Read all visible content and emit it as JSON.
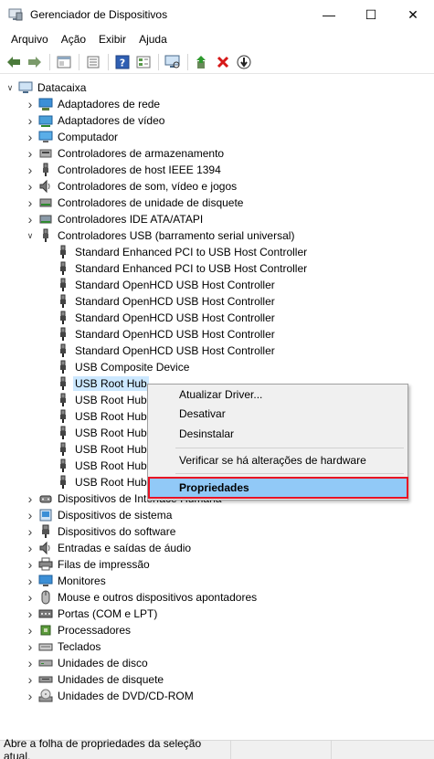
{
  "window": {
    "title": "Gerenciador de Dispositivos",
    "minimize_glyph": "—",
    "maximize_glyph": "☐",
    "close_glyph": "✕"
  },
  "menu": [
    "Arquivo",
    "Ação",
    "Exibir",
    "Ajuda"
  ],
  "toolbar": {
    "buttons": [
      "back-arrow-icon",
      "forward-arrow-icon",
      "properties-pane-icon",
      "list-view-icon",
      "help-icon",
      "details-icon",
      "monitor-scan-icon",
      "update-driver-icon",
      "uninstall-x-icon",
      "disable-down-icon"
    ]
  },
  "tree": {
    "root": "Datacaixa",
    "categories": [
      {
        "label": "Adaptadores de rede",
        "icon": "network-icon"
      },
      {
        "label": "Adaptadores de vídeo",
        "icon": "display-adapter-icon"
      },
      {
        "label": "Computador",
        "icon": "computer-icon"
      },
      {
        "label": "Controladores de armazenamento",
        "icon": "storage-controller-icon"
      },
      {
        "label": "Controladores de host IEEE 1394",
        "icon": "usb-plug-icon"
      },
      {
        "label": "Controladores de som, vídeo e jogos",
        "icon": "speaker-icon"
      },
      {
        "label": "Controladores de unidade de disquete",
        "icon": "floppy-controller-icon"
      },
      {
        "label": "Controladores IDE ATA/ATAPI",
        "icon": "ide-controller-icon"
      },
      {
        "label": "Controladores USB (barramento serial universal)",
        "icon": "usb-plug-icon",
        "expanded": true
      }
    ],
    "usb_children": [
      "Standard Enhanced PCI to USB Host Controller",
      "Standard Enhanced PCI to USB Host Controller",
      "Standard OpenHCD USB Host Controller",
      "Standard OpenHCD USB Host Controller",
      "Standard OpenHCD USB Host Controller",
      "Standard OpenHCD USB Host Controller",
      "Standard OpenHCD USB Host Controller",
      "USB Composite Device",
      "USB Root Hub",
      "USB Root Hub",
      "USB Root Hub",
      "USB Root Hub",
      "USB Root Hub",
      "USB Root Hub",
      "USB Root Hub"
    ],
    "more_categories": [
      {
        "label": "Dispositivos de Interface Humana",
        "icon": "hid-icon"
      },
      {
        "label": "Dispositivos de sistema",
        "icon": "system-devices-icon"
      },
      {
        "label": "Dispositivos do software",
        "icon": "software-device-icon"
      },
      {
        "label": "Entradas e saídas de áudio",
        "icon": "speaker-icon"
      },
      {
        "label": "Filas de impressão",
        "icon": "printer-icon"
      },
      {
        "label": "Monitores",
        "icon": "monitor-icon"
      },
      {
        "label": "Mouse e outros dispositivos apontadores",
        "icon": "mouse-icon"
      },
      {
        "label": "Portas (COM e LPT)",
        "icon": "port-icon"
      },
      {
        "label": "Processadores",
        "icon": "processor-icon"
      },
      {
        "label": "Teclados",
        "icon": "keyboard-icon"
      },
      {
        "label": "Unidades de disco",
        "icon": "disk-drive-icon"
      },
      {
        "label": "Unidades de disquete",
        "icon": "floppy-drive-icon"
      },
      {
        "label": "Unidades de DVD/CD-ROM",
        "icon": "dvd-drive-icon"
      }
    ]
  },
  "context_menu": {
    "items": [
      "Atualizar Driver...",
      "Desativar",
      "Desinstalar",
      "Verificar se há alterações de hardware",
      "Propriedades"
    ]
  },
  "status": {
    "text": "Abre a folha de propriedades da seleção atual."
  },
  "colors": {
    "selection": "#cce8ff",
    "menu_highlight": "#91c9f7",
    "annotation_border": "#e81123"
  }
}
